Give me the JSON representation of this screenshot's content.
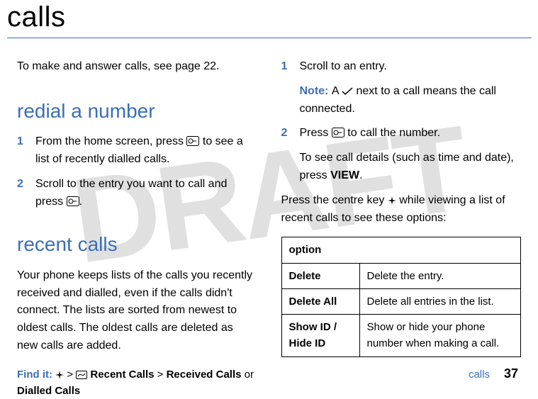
{
  "watermark": "DRAFT",
  "title": "calls",
  "left": {
    "intro": "To make and answer calls, see page 22.",
    "h_redial": "redial a number",
    "redial_steps": [
      {
        "pre": "From the home screen, press ",
        "post": " to see a list of recently dialled calls."
      },
      {
        "pre": "Scroll to the entry you want to call and press ",
        "post": "."
      }
    ],
    "h_recent": "recent calls",
    "recent_para": "Your phone keeps lists of the calls you recently received and dialled, even if the calls didn't connect. The lists are sorted from newest to oldest calls. The oldest calls are deleted as new calls are added.",
    "findit_label": "Find it: ",
    "findit_sep1": " > ",
    "findit_text1": " Recent Calls",
    "findit_sep2": " > ",
    "findit_text2": "Received Calls",
    "findit_or": " or ",
    "findit_text3": "Dialled Calls"
  },
  "right": {
    "steps": [
      {
        "text": "Scroll to an entry."
      },
      {
        "pre": "Press ",
        "post": " to call the number."
      }
    ],
    "note_label": "Note: ",
    "note_pre": "A ",
    "note_post": " next to a call means the call connected.",
    "detail_pre": "To see call details (such as time and date), press ",
    "detail_view": "VIEW",
    "detail_post": ".",
    "centre_pre": "Press the centre key ",
    "centre_post": " while viewing a list of recent calls to see these options:",
    "table_header": "option",
    "options": [
      {
        "name": "Delete",
        "desc": "Delete the entry."
      },
      {
        "name": "Delete All",
        "desc": "Delete all entries in the list."
      },
      {
        "name": "Show ID / Hide ID",
        "desc": "Show or hide your phone number when making a call."
      }
    ]
  },
  "footer": {
    "section": "calls",
    "page": "37"
  }
}
